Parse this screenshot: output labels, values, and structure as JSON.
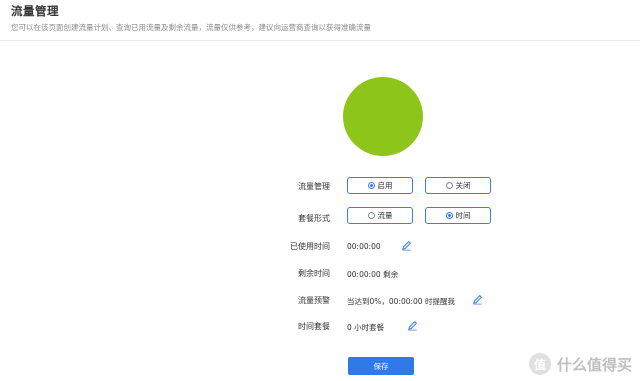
{
  "header": {
    "title": "流量管理",
    "description": "您可以在该页面创建流量计划、查询已用流量及剩余流量，流量仅供参考，建议向运营商查询以获得准确流量"
  },
  "usage": {
    "color": "#8ec51a"
  },
  "form": {
    "traffic_mgmt": {
      "label": "流量管理",
      "options": [
        "启用",
        "关闭"
      ],
      "selected": "启用"
    },
    "plan_type": {
      "label": "套餐形式",
      "options": [
        "流量",
        "时间"
      ],
      "selected": "时间"
    },
    "used_time": {
      "label": "已使用时间",
      "value": "00:00:00"
    },
    "remaining_time": {
      "label": "剩余时间",
      "value": "00:00:00 剩余"
    },
    "traffic_alert": {
      "label": "流量预警",
      "value": "当达到0%，00:00:00 时提醒我"
    },
    "time_plan": {
      "label": "时间套餐",
      "value": "0 小时套餐"
    }
  },
  "actions": {
    "save_label": "保存"
  },
  "watermark": {
    "badge": "值",
    "text": "什么值得买"
  },
  "colors": {
    "accent": "#2f7be5",
    "border": "#3c7de0",
    "usage_fill": "#8ec51a"
  }
}
